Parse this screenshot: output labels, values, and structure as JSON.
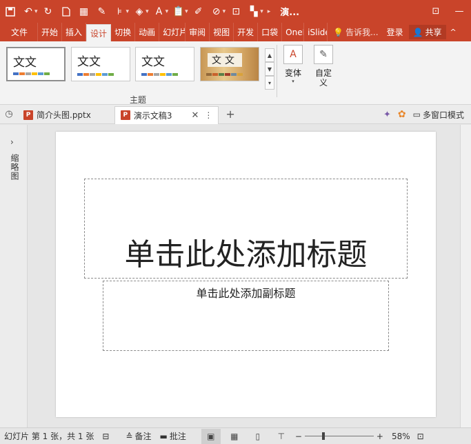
{
  "window": {
    "title": "演...",
    "qat_icons": [
      "save-icon",
      "undo-icon",
      "redo-icon",
      "new-doc-icon",
      "grid-icon",
      "pen-icon",
      "format-icon",
      "fill-icon",
      "font-color-icon",
      "paste-icon",
      "brush-icon",
      "shape-icon",
      "crop-icon",
      "layout-icon"
    ]
  },
  "tabs": {
    "file": "文件",
    "items": [
      "开始",
      "插入",
      "设计",
      "切换",
      "动画",
      "幻灯片",
      "审阅",
      "视图",
      "开发",
      "口袋",
      "OneI",
      "iSlide"
    ],
    "active_index": 2,
    "tell": "告诉我...",
    "login": "登录",
    "share": "共享"
  },
  "ribbon": {
    "themes": [
      {
        "text": "文文",
        "colors": [
          "#4472c4",
          "#ed7d31",
          "#a5a5a5",
          "#ffc000",
          "#5b9bd5",
          "#70ad47"
        ]
      },
      {
        "text": "文文",
        "colors": [
          "#4472c4",
          "#ed7d31",
          "#a5a5a5",
          "#ffc000",
          "#5b9bd5",
          "#70ad47"
        ]
      },
      {
        "text": "文文",
        "colors": [
          "#4472c4",
          "#ed7d31",
          "#a5a5a5",
          "#ffc000",
          "#5b9bd5",
          "#70ad47"
        ]
      },
      {
        "text": "文文",
        "colors": [
          "#93693a",
          "#c8612c",
          "#5a7f48",
          "#a33a2a",
          "#6f8a9e",
          "#d8a23c"
        ]
      }
    ],
    "group_label": "主题",
    "variant_label": "变体",
    "customize_label": "自定义"
  },
  "doctabs": {
    "tabs": [
      {
        "name": "简介头图.pptx",
        "active": false
      },
      {
        "name": "演示文稿3",
        "active": true
      }
    ],
    "multiwindow": "多窗口模式"
  },
  "leftpane": {
    "label": "缩略图"
  },
  "slide": {
    "title_placeholder": "单击此处添加标题",
    "subtitle_placeholder": "单击此处添加副标题"
  },
  "status": {
    "slide_info": "幻灯片 第 1 张，共 1 张",
    "notes": "备注",
    "comments": "批注",
    "zoom": "58%",
    "zoom_level": 0.58
  },
  "colors": {
    "accent": "#c9442a"
  }
}
